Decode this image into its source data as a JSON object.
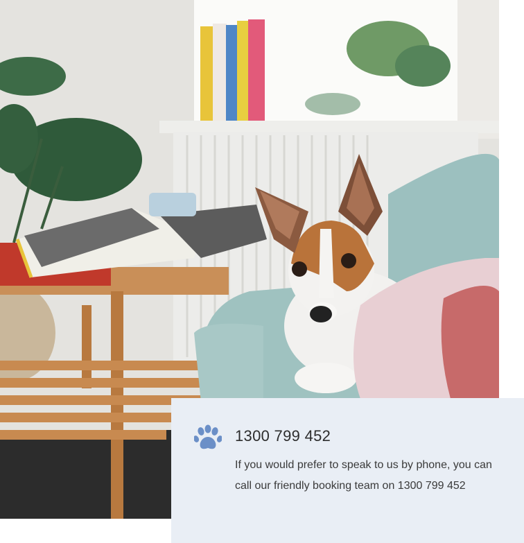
{
  "photo": {
    "description_icon": "dog-photo"
  },
  "contact": {
    "icon": "paw-icon",
    "phone": "1300 799 452",
    "text": "If you would prefer to speak to us by phone, you can call our friendly booking team on 1300 799 452"
  },
  "colors": {
    "card_bg": "#e9eef5",
    "paw": "#6b8fc7",
    "text": "#3a3a3a"
  }
}
